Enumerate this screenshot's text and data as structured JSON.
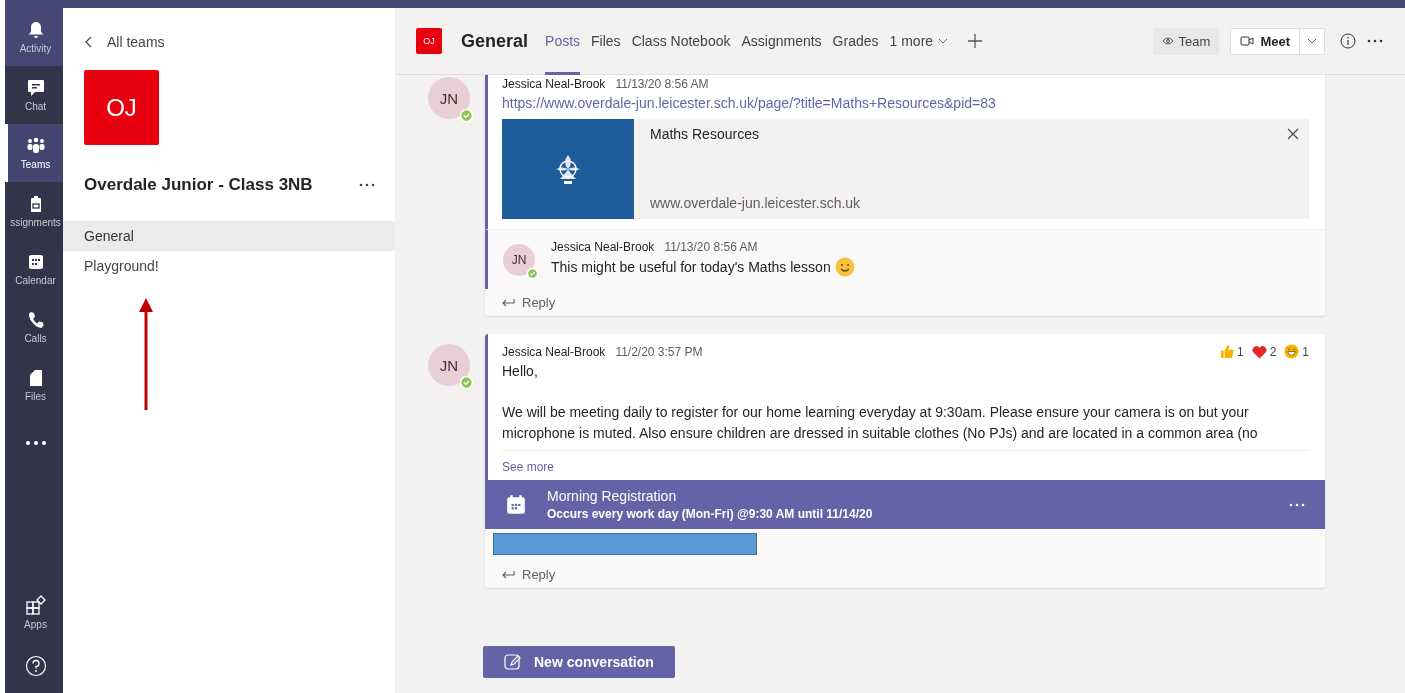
{
  "rail": [
    {
      "label": "Activity",
      "kind": "bell",
      "selected": false
    },
    {
      "label": "Chat",
      "kind": "chat",
      "selected": false
    },
    {
      "label": "Teams",
      "kind": "teams",
      "selected": true
    },
    {
      "label": "ssignments",
      "kind": "bag",
      "selected": false
    },
    {
      "label": "Calendar",
      "kind": "calendar",
      "selected": false
    },
    {
      "label": "Calls",
      "kind": "phone",
      "selected": false
    },
    {
      "label": "Files",
      "kind": "file",
      "selected": false
    },
    {
      "kind": "more",
      "selected": false
    }
  ],
  "rail_bottom": [
    {
      "label": "Apps",
      "kind": "apps"
    },
    {
      "kind": "help"
    }
  ],
  "team_panel": {
    "back": "All teams",
    "initials": "OJ",
    "name": "Overdale Junior - Class 3NB",
    "channels": [
      {
        "label": "General",
        "selected": true
      },
      {
        "label": "Playground!",
        "selected": false
      }
    ]
  },
  "header": {
    "initials": "OJ",
    "channel": "General",
    "tabs": [
      {
        "label": "Posts",
        "selected": true
      },
      {
        "label": "Files",
        "selected": false
      },
      {
        "label": "Class Notebook",
        "selected": false
      },
      {
        "label": "Assignments",
        "selected": false
      },
      {
        "label": "Grades",
        "selected": false
      }
    ],
    "more_tabs": "1 more",
    "team_button": "Team",
    "meet_button": "Meet"
  },
  "threads": [
    {
      "initials": "JN",
      "author": "Jessica Neal-Brook",
      "time": "11/13/20 8:56 AM",
      "link": "https://www.overdale-jun.leicester.sch.uk/page/?title=Maths+Resources&pid=83",
      "preview": {
        "title": "Maths Resources",
        "url": "www.overdale-jun.leicester.sch.uk"
      },
      "replies": [
        {
          "initials": "JN",
          "author": "Jessica Neal-Brook",
          "time": "11/13/20 8:56 AM",
          "text": "This might be useful for today's Maths lesson"
        }
      ],
      "reply_label": "Reply"
    },
    {
      "initials": "JN",
      "author": "Jessica Neal-Brook",
      "time": "11/2/20 3:57 PM",
      "reactions": [
        {
          "kind": "like",
          "count": "1"
        },
        {
          "kind": "heart",
          "count": "2"
        },
        {
          "kind": "laugh",
          "count": "1"
        }
      ],
      "paragraphs": [
        "Hello,",
        "We will be meeting daily to register for our home learning everyday at 9:30am. Please ensure your camera is on but your microphone is muted. Also ensure children are dressed in suitable clothes (No PJs) and are located in a common area (no"
      ],
      "see_more": "See more",
      "meeting": {
        "title": "Morning Registration",
        "subtitle": "Occurs every work day (Mon-Fri) @9:30 AM until 11/14/20"
      },
      "redacted": true,
      "reply_label": "Reply"
    }
  ],
  "new_conversation": "New conversation"
}
